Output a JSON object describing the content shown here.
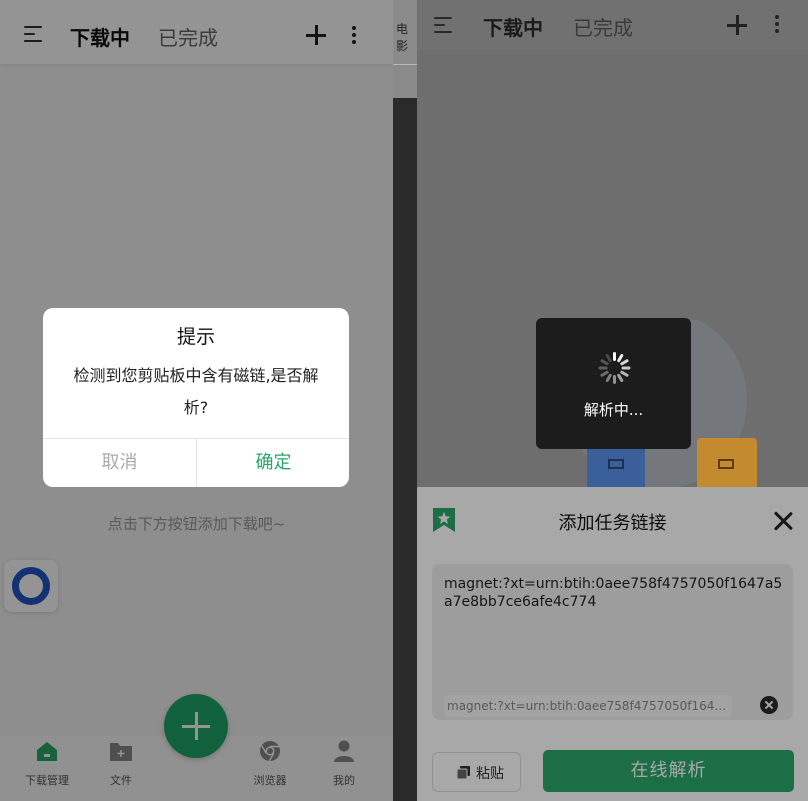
{
  "left": {
    "header": {
      "tab_downloading": "下载中",
      "tab_completed": "已完成",
      "menu_icon": "menu-icon",
      "add_icon": "plus-icon",
      "more_icon": "more-vertical-icon"
    },
    "empty_hint": "点击下方按钮添加下载吧~",
    "bottom_nav": [
      {
        "label": "下载管理",
        "icon": "home-icon"
      },
      {
        "label": "文件",
        "icon": "folder-icon"
      },
      {
        "label": "浏览器",
        "icon": "browser-icon"
      },
      {
        "label": "我的",
        "icon": "user-icon"
      }
    ],
    "dialog": {
      "title": "提示",
      "message": "检测到您剪贴板中含有磁链,是否解析?",
      "cancel": "取消",
      "confirm": "确定"
    }
  },
  "right": {
    "side_tab_text": "电影",
    "header": {
      "tab_downloading": "下载中",
      "tab_completed": "已完成"
    },
    "toast": {
      "label": "解析中..."
    },
    "sheet": {
      "title": "添加任务链接",
      "input_value": "magnet:?xt=urn:btih:0aee758f4757050f1647a5a7e8bb7ce6afe4c774",
      "history_item": "magnet:?xt=urn:btih:0aee758f4757050f1647...",
      "paste_label": "粘贴",
      "parse_label": "在线解析"
    }
  },
  "colors": {
    "accent_green": "#2aa86a",
    "fab_green": "#1fa86a",
    "dialog_confirm": "#2aa56a",
    "float_ring_blue": "#1f56c9"
  }
}
